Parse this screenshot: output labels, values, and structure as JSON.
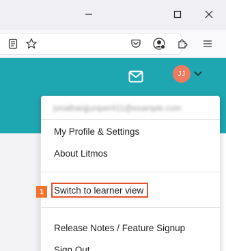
{
  "window_controls": {
    "minimize_icon": "minimize-icon",
    "maximize_icon": "maximize-icon",
    "close_icon": "close-icon"
  },
  "toolbar": {
    "icons": [
      "reader-view-icon",
      "bookmark-star-icon",
      "pocket-icon",
      "account-icon",
      "extensions-icon",
      "menu-icon"
    ]
  },
  "header": {
    "accent_color": "#1fa7b1",
    "mail_icon": "mail-icon",
    "avatar_initials": "JJ",
    "avatar_color": "#ee7a5f",
    "caret_icon": "chevron-down-icon"
  },
  "dropdown": {
    "email": "jonathanjjuniper411@example.com",
    "items": [
      {
        "label": "My Profile & Settings"
      },
      {
        "label": "About Litmos"
      },
      {
        "label": "Switch to learner view"
      },
      {
        "label": "Release Notes / Feature Signup"
      },
      {
        "label": "Sign Out"
      }
    ]
  },
  "annotation": {
    "badge_label": "1",
    "highlight_color": "#e0532a"
  }
}
